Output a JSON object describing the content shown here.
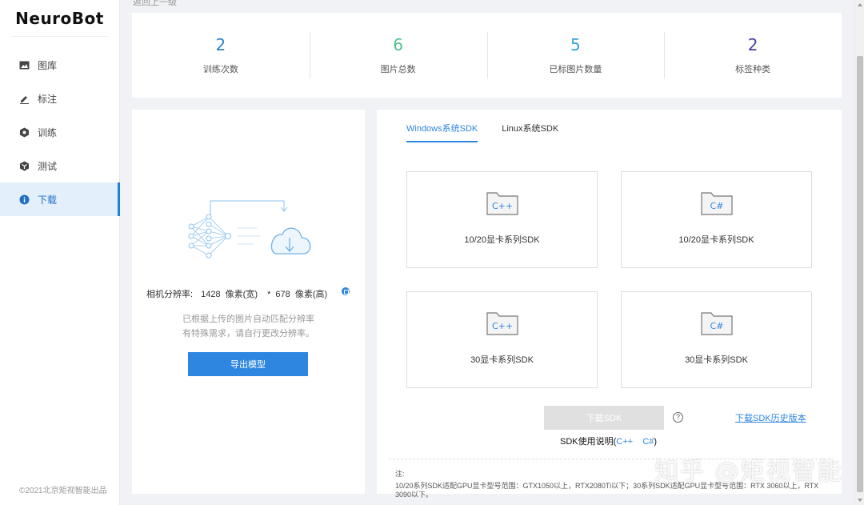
{
  "app": {
    "logo_text": "NeuroBot"
  },
  "breadcrumb": "返回上一级",
  "sidebar": {
    "items": [
      {
        "label": "图库",
        "icon": "image-icon"
      },
      {
        "label": "标注",
        "icon": "edit-icon"
      },
      {
        "label": "训练",
        "icon": "hexagon-icon"
      },
      {
        "label": "测试",
        "icon": "cube-icon"
      },
      {
        "label": "下载",
        "icon": "info-icon",
        "active": true
      }
    ],
    "copyright": "©2021北京矩视智能出品"
  },
  "stats": [
    {
      "value": "2",
      "label": "训练次数",
      "color": "#2f80c8"
    },
    {
      "value": "6",
      "label": "图片总数",
      "color": "#4fc18c"
    },
    {
      "value": "5",
      "label": "已标图片数量",
      "color": "#33a3de"
    },
    {
      "value": "2",
      "label": "标签种类",
      "color": "#3f3fa8"
    }
  ],
  "left_panel": {
    "resolution_label": "相机分辨率:",
    "width_value": "1428",
    "width_unit": "像素(宽)",
    "separator": "*",
    "height_value": "678",
    "height_unit": "像素(高)",
    "hint_line1": "已根据上传的图片自动匹配分辨率",
    "hint_line2": "有特殊需求，请自行更改分辨率。",
    "export_button": "导出模型"
  },
  "right_panel": {
    "tabs": [
      {
        "label": "Windows系统SDK",
        "active": true
      },
      {
        "label": "Linux系统SDK",
        "active": false
      }
    ],
    "cards": [
      {
        "lang": "C++",
        "caption": "10/20显卡系列SDK"
      },
      {
        "lang": "C#",
        "caption": "10/20显卡系列SDK"
      },
      {
        "lang": "C++",
        "caption": "30显卡系列SDK"
      },
      {
        "lang": "C#",
        "caption": "30显卡系列SDK"
      }
    ],
    "download_button": "下载SDK",
    "help_symbol": "?",
    "history_link": "下载SDK历史版本",
    "usage_prefix": "SDK使用说明(",
    "usage_cpp": "C++",
    "usage_csharp": "C#",
    "usage_suffix": ")",
    "note_label": "注:",
    "note_text": "10/20系列SDK适配GPU显卡型号范围：GTX1050以上，RTX2080Ti以下；30系列SDK适配GPU显卡型号范围：RTX 3060以上，RTX 3090以下。"
  },
  "watermark": "知乎 @矩视智能",
  "colors": {
    "accent": "#2f86e0",
    "active_bg": "#e3effb",
    "disabled": "#e0e0e0"
  }
}
